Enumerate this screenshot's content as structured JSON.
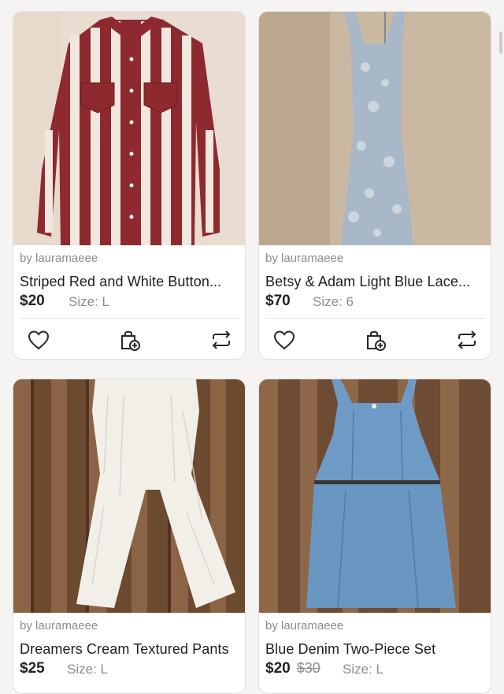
{
  "listings": [
    {
      "seller": "by lauramaeee",
      "title": "Striped Red and White Button...",
      "price": "$20",
      "size": "Size: L",
      "image": "red-white-striped-western-shirt"
    },
    {
      "seller": "by lauramaeee",
      "title": "Betsy & Adam Light Blue Lace...",
      "price": "$70",
      "size": "Size: 6",
      "image": "light-blue-lace-gown"
    },
    {
      "seller": "by lauramaeee",
      "title": "Dreamers Cream Textured Pants",
      "price": "$25",
      "size": "Size: L",
      "image": "cream-textured-pants"
    },
    {
      "seller": "by lauramaeee",
      "title": "Blue Denim Two-Piece Set",
      "price": "$20",
      "original_price": "$30",
      "size": "Size: L",
      "image": "blue-denim-two-piece-set"
    }
  ],
  "icons": {
    "like": "heart-icon",
    "bundle": "bag-add-icon",
    "share": "repost-icon"
  },
  "colors": {
    "background": "#f6f4f2",
    "card": "#ffffff",
    "text": "#1f1d1c",
    "muted": "#8e8b88"
  }
}
